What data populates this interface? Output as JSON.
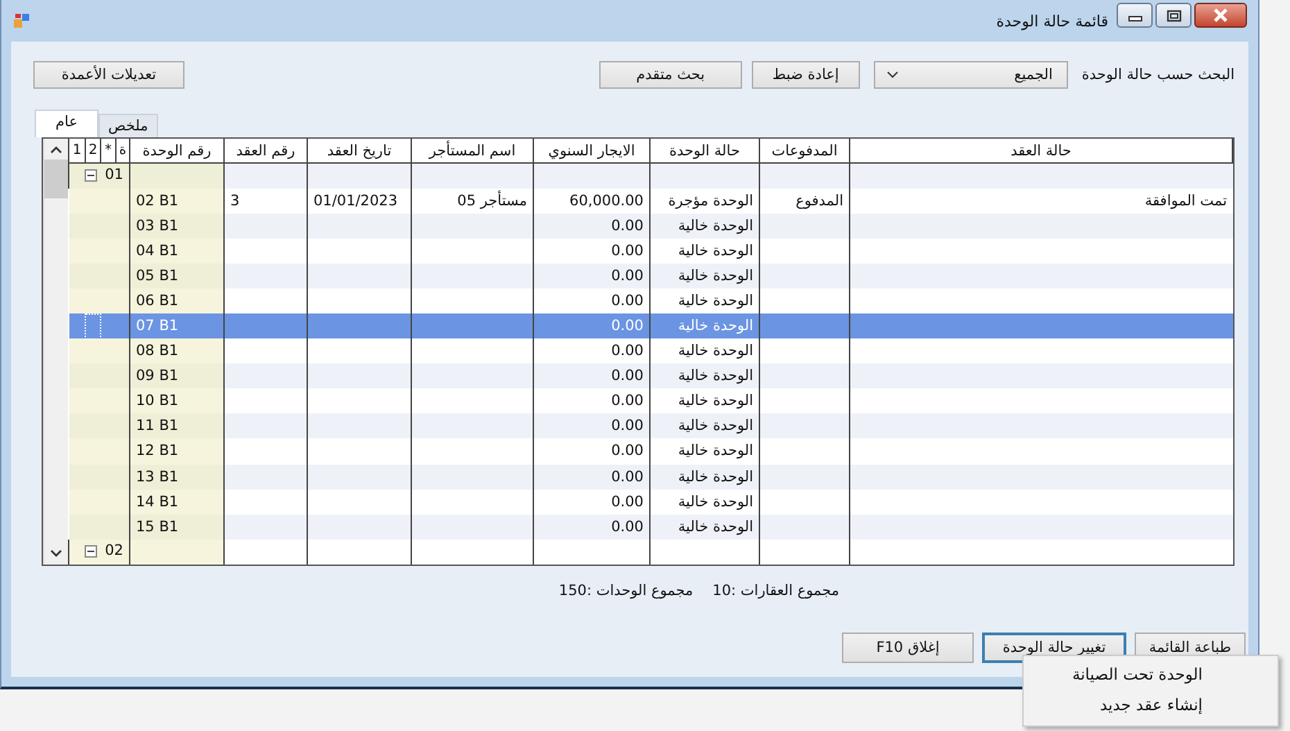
{
  "window": {
    "title": "قائمة حالة الوحدة"
  },
  "filter": {
    "label": "البحث حسب حالة الوحدة",
    "value": "الجميع"
  },
  "top_buttons": [
    "إعادة ضبط",
    "بحث متقدم"
  ],
  "columns_button": "تعديلات الأعمدة",
  "tabs": [
    {
      "label": "ملخص",
      "selected": false
    },
    {
      "label": "عام",
      "selected": true
    }
  ],
  "table": {
    "columns": [
      "حالة العقد",
      "المدفوعات",
      "حالة الوحدة",
      "الايجار السنوي",
      "اسم المستأجر",
      "تاريخ العقد",
      "رقم العقد",
      "رقم الوحدة",
      "ة",
      "*",
      "2",
      "1"
    ],
    "rows": [
      {
        "kind": "group",
        "label": "01",
        "expanded": true,
        "selected": false
      },
      {
        "kind": "unit",
        "unit": "02 B1",
        "contract_no": "3",
        "contract_date": "01/01/2023",
        "tenant": "مستأجر 05",
        "rent": "60,000.00",
        "unit_status": "الوحدة مؤجرة",
        "payments": "المدفوع",
        "contract_status": "تمت الموافقة",
        "selected": false
      },
      {
        "kind": "unit",
        "unit": "03 B1",
        "rent": "0.00",
        "unit_status": "الوحدة خالية",
        "selected": false
      },
      {
        "kind": "unit",
        "unit": "04 B1",
        "rent": "0.00",
        "unit_status": "الوحدة خالية",
        "selected": false
      },
      {
        "kind": "unit",
        "unit": "05 B1",
        "rent": "0.00",
        "unit_status": "الوحدة خالية",
        "selected": false
      },
      {
        "kind": "unit",
        "unit": "06 B1",
        "rent": "0.00",
        "unit_status": "الوحدة خالية",
        "selected": false
      },
      {
        "kind": "unit",
        "unit": "07 B1",
        "rent": "0.00",
        "unit_status": "الوحدة خالية",
        "selected": true
      },
      {
        "kind": "unit",
        "unit": "08 B1",
        "rent": "0.00",
        "unit_status": "الوحدة خالية",
        "selected": false
      },
      {
        "kind": "unit",
        "unit": "09 B1",
        "rent": "0.00",
        "unit_status": "الوحدة خالية",
        "selected": false
      },
      {
        "kind": "unit",
        "unit": "10 B1",
        "rent": "0.00",
        "unit_status": "الوحدة خالية",
        "selected": false
      },
      {
        "kind": "unit",
        "unit": "11 B1",
        "rent": "0.00",
        "unit_status": "الوحدة خالية",
        "selected": false
      },
      {
        "kind": "unit",
        "unit": "12 B1",
        "rent": "0.00",
        "unit_status": "الوحدة خالية",
        "selected": false
      },
      {
        "kind": "unit",
        "unit": "13 B1",
        "rent": "0.00",
        "unit_status": "الوحدة خالية",
        "selected": false
      },
      {
        "kind": "unit",
        "unit": "14 B1",
        "rent": "0.00",
        "unit_status": "الوحدة خالية",
        "selected": false
      },
      {
        "kind": "unit",
        "unit": "15 B1",
        "rent": "0.00",
        "unit_status": "الوحدة خالية",
        "selected": false
      },
      {
        "kind": "group",
        "label": "02",
        "expanded": true,
        "selected": false
      }
    ]
  },
  "totals": [
    "مجموع العقارات :10",
    "مجموع الوحدات :150"
  ],
  "bottom_buttons": [
    {
      "label": "طباعة القائمة",
      "focused": false
    },
    {
      "label": "تغيير حالة الوحدة",
      "focused": true
    },
    {
      "label": "إغلاق F10",
      "focused": false
    }
  ],
  "context_menu": [
    "الوحدة تحت الصيانة",
    "إنشاء عقد جديد"
  ]
}
